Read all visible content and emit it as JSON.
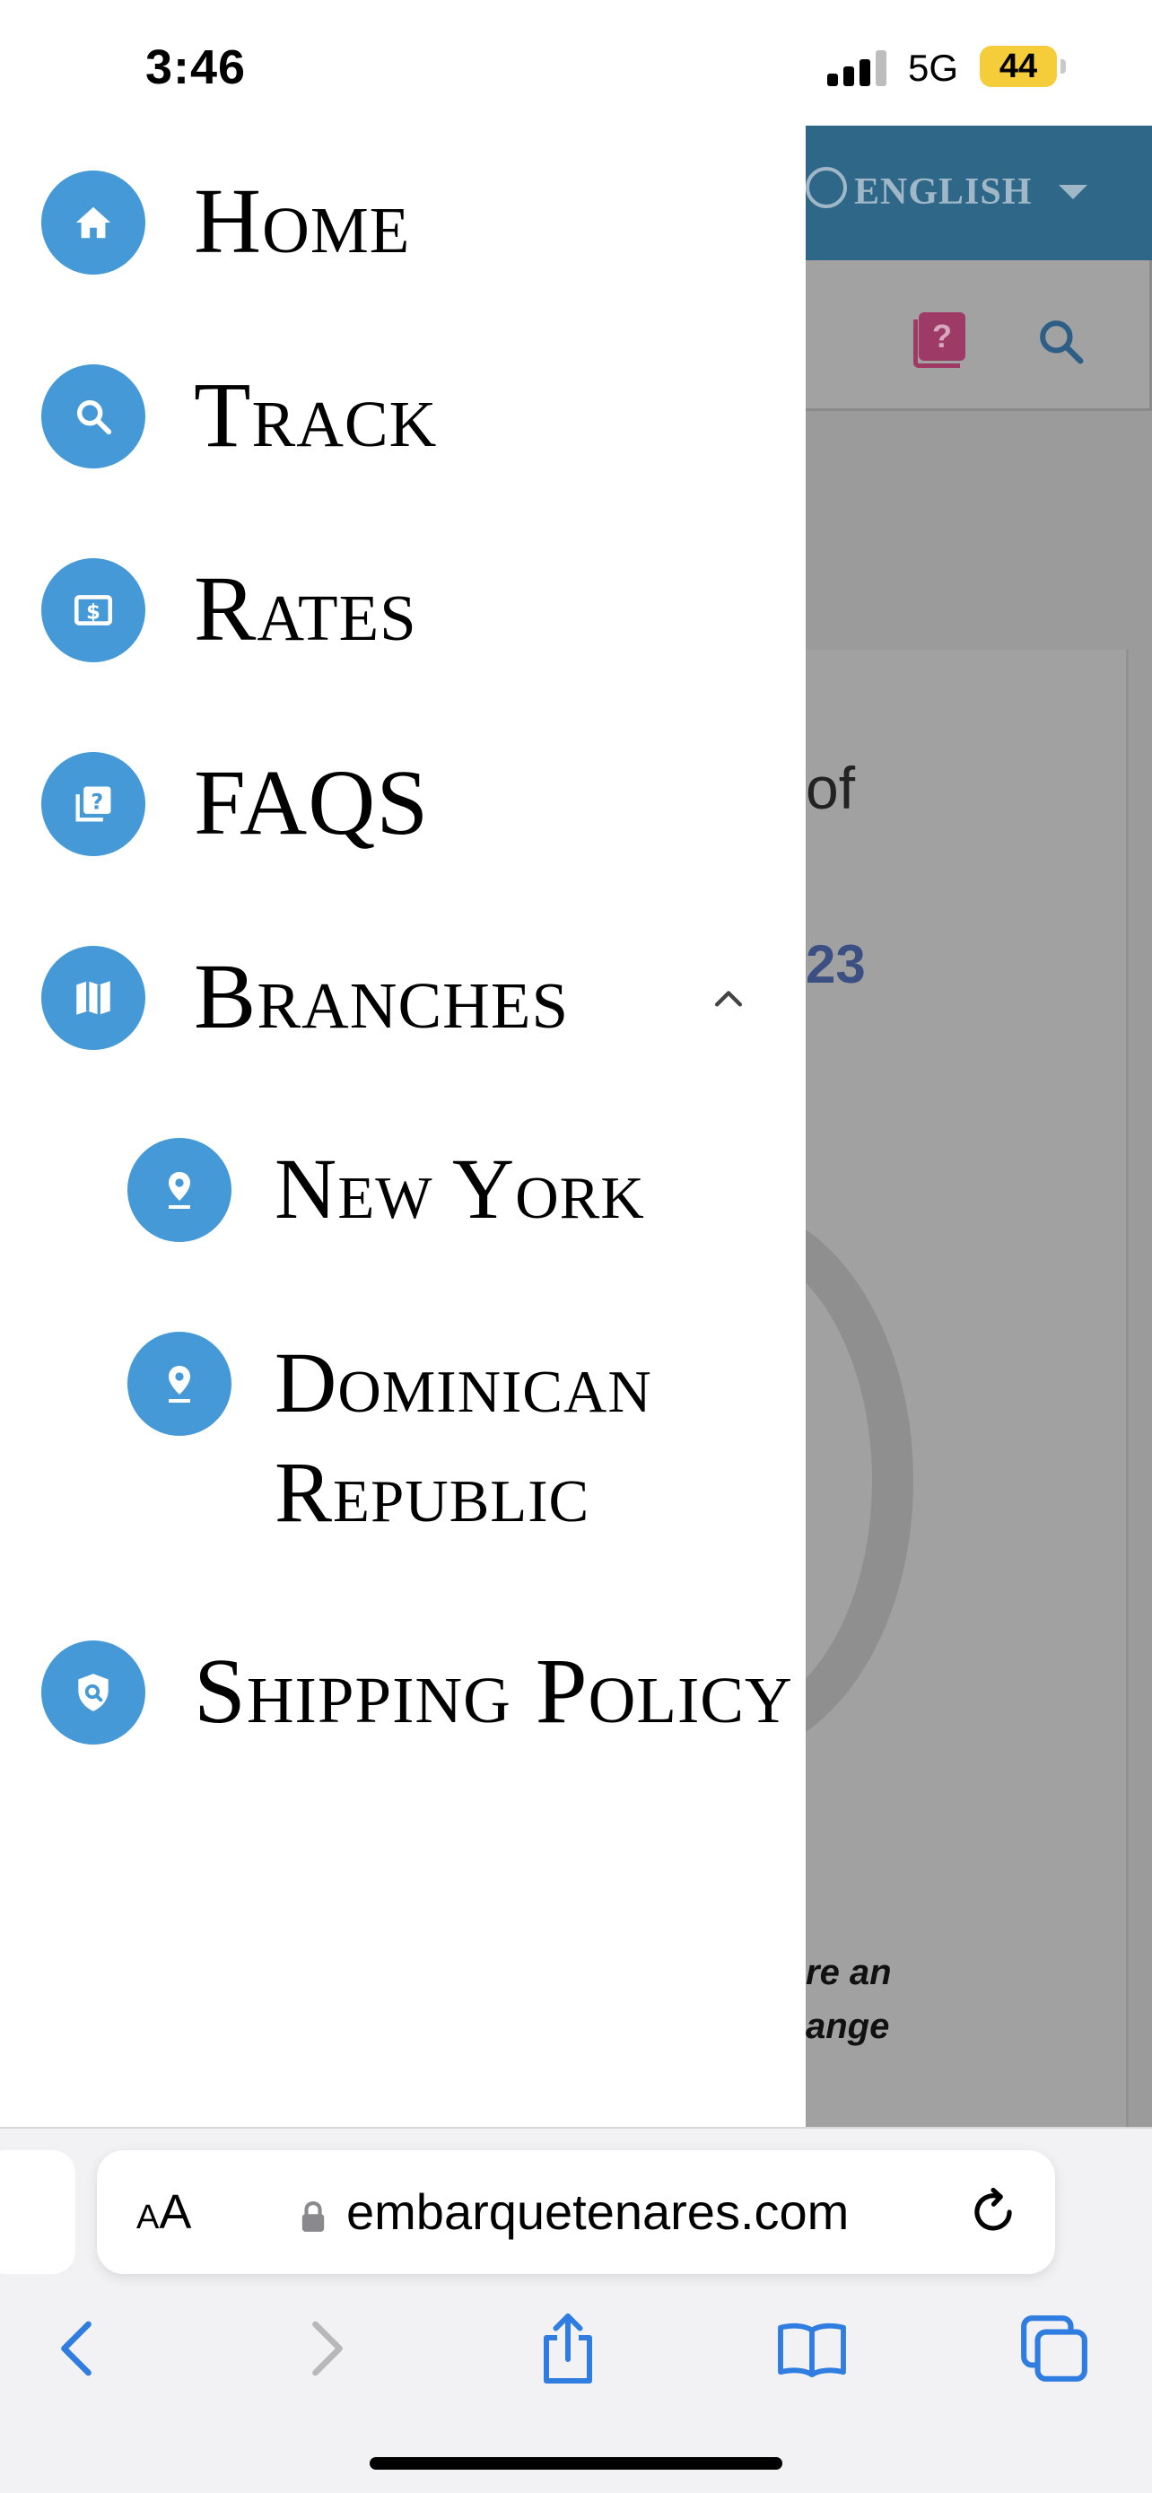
{
  "status_bar": {
    "time": "3:46",
    "network": "5G",
    "battery": "44"
  },
  "background_page": {
    "language": "ENGLISH",
    "text_of": "of",
    "text_number": "23",
    "text_italic_1": "re an",
    "text_italic_2": "ange"
  },
  "drawer": {
    "items": [
      {
        "label": "Home",
        "icon": "home-icon"
      },
      {
        "label": "Track",
        "icon": "search-icon"
      },
      {
        "label": "Rates",
        "icon": "dollar-icon"
      },
      {
        "label": "FAQS",
        "icon": "faq-icon"
      },
      {
        "label": "Branches",
        "icon": "map-icon",
        "expanded": true,
        "children": [
          {
            "label": "New York",
            "icon": "location-pin-icon"
          },
          {
            "label": "Dominican",
            "label_line2": "Republic",
            "icon": "location-pin-icon"
          }
        ]
      },
      {
        "label": "Shipping Policy",
        "icon": "shield-search-icon"
      }
    ]
  },
  "browser": {
    "aa_label_small": "A",
    "aa_label_large": "A",
    "url": "embarquetenares.com"
  },
  "colors": {
    "icon_circle": "#4499d6",
    "header_blue": "#2e6787",
    "browser_blue": "#2f7de1"
  }
}
